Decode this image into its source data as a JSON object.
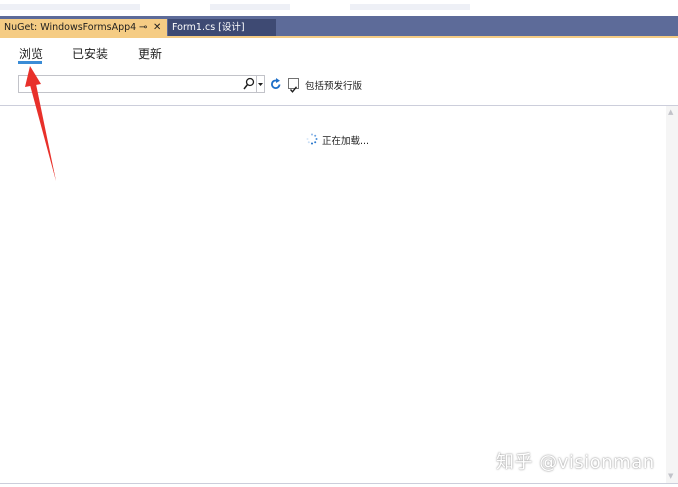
{
  "tabs": [
    {
      "label": "NuGet: WindowsFormsApp4",
      "pin": "⊸",
      "close": "✕",
      "active": true
    },
    {
      "label": "Form1.cs [设计]",
      "active": false
    }
  ],
  "subtabs": [
    {
      "label": "浏览",
      "active": true
    },
    {
      "label": "已安装",
      "active": false
    },
    {
      "label": "更新",
      "active": false
    }
  ],
  "search": {
    "value": "",
    "placeholder": ""
  },
  "prerelease": {
    "label": "包括预发行版",
    "checked": true
  },
  "status": {
    "loading_text": "正在加载..."
  },
  "watermark": "知乎 @visionman",
  "colors": {
    "tabbar": "#5d6b99",
    "active_tab": "#f5cc84",
    "inactive_tab": "#3e4a73",
    "accent": "#3a8cd6",
    "annotation": "#e8302a"
  },
  "icons": [
    "search-icon",
    "dropdown-arrow-icon",
    "refresh-icon",
    "checkmark-icon",
    "spinner-icon",
    "annotation-arrow"
  ]
}
